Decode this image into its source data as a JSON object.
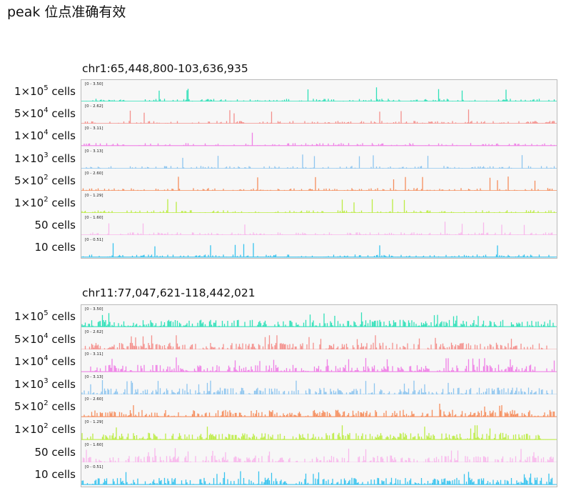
{
  "title": "peak 位点准确有效",
  "panels": [
    {
      "locus": "chr1:65,448,800-103,636,935",
      "tracks": [
        {
          "mantissa": "1×10",
          "exp": "5",
          "suffix": " cells",
          "range": "[0 - 3.50]",
          "color": "#2fe0b8"
        },
        {
          "mantissa": "5×10",
          "exp": "4",
          "suffix": " cells",
          "range": "[0 - 2.62]",
          "color": "#f4908c"
        },
        {
          "mantissa": "1×10",
          "exp": "4",
          "suffix": " cells",
          "range": "[0 - 3.11]",
          "color": "#ef7fe6"
        },
        {
          "mantissa": "1×10",
          "exp": "3",
          "suffix": " cells",
          "range": "[0 - 3.13]",
          "color": "#8ec5ef"
        },
        {
          "mantissa": "5×10",
          "exp": "2",
          "suffix": " cells",
          "range": "[0 - 2.60]",
          "color": "#f58d5c"
        },
        {
          "mantissa": "1×10",
          "exp": "2",
          "suffix": " cells",
          "range": "[0 - 1.29]",
          "color": "#bcec44"
        },
        {
          "mantissa": "50",
          "exp": "",
          "suffix": " cells",
          "range": "[0 - 1.60]",
          "color": "#f8b8ec"
        },
        {
          "mantissa": "10",
          "exp": "",
          "suffix": " cells",
          "range": "[0 - 0.51]",
          "color": "#37c3ee"
        }
      ]
    },
    {
      "locus": "chr11:77,047,621-118,442,021",
      "tracks": [
        {
          "mantissa": "1×10",
          "exp": "5",
          "suffix": " cells",
          "range": "[0 - 3.50]",
          "color": "#2fe0b8"
        },
        {
          "mantissa": "5×10",
          "exp": "4",
          "suffix": " cells",
          "range": "[0 - 2.62]",
          "color": "#f4908c"
        },
        {
          "mantissa": "1×10",
          "exp": "4",
          "suffix": " cells",
          "range": "[0 - 3.11]",
          "color": "#ef7fe6"
        },
        {
          "mantissa": "1×10",
          "exp": "3",
          "suffix": " cells",
          "range": "[0 - 3.13]",
          "color": "#8ec5ef"
        },
        {
          "mantissa": "5×10",
          "exp": "2",
          "suffix": " cells",
          "range": "[0 - 2.60]",
          "color": "#f58d5c"
        },
        {
          "mantissa": "1×10",
          "exp": "2",
          "suffix": " cells",
          "range": "[0 - 1.29]",
          "color": "#bcec44"
        },
        {
          "mantissa": "50",
          "exp": "",
          "suffix": " cells",
          "range": "[0 - 1.60]",
          "color": "#f8b8ec"
        },
        {
          "mantissa": "10",
          "exp": "",
          "suffix": " cells",
          "range": "[0 - 0.51]",
          "color": "#37c3ee"
        }
      ]
    }
  ]
}
